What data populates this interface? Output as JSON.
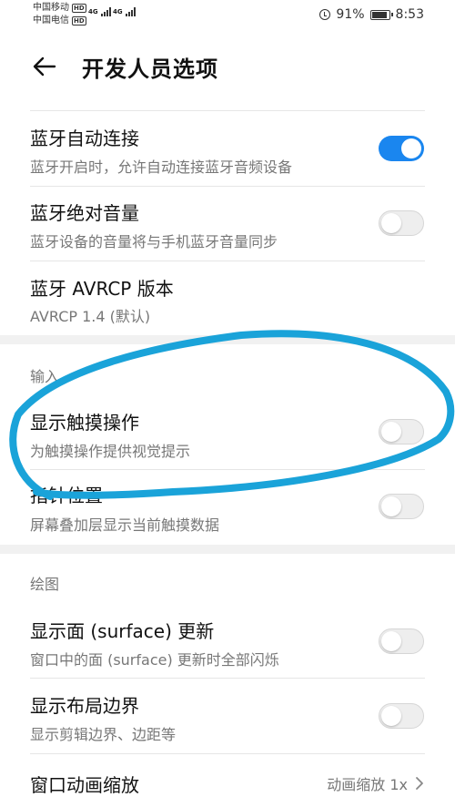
{
  "status_bar": {
    "carrier_1": "中国移动",
    "carrier_2": "中国电信",
    "hd_badge": "HD",
    "network_1": "4G",
    "network_2": "4G",
    "battery": "91%",
    "time": "8:53"
  },
  "header": {
    "title": "开发人员选项"
  },
  "items": [
    {
      "title": "蓝牙自动连接",
      "subtitle": "蓝牙开启时，允许自动连接蓝牙音频设备",
      "toggle": "on"
    },
    {
      "title": "蓝牙绝对音量",
      "subtitle": "蓝牙设备的音量将与手机蓝牙音量同步",
      "toggle": "off"
    },
    {
      "title": "蓝牙 AVRCP 版本",
      "subtitle": "AVRCP 1.4 (默认)"
    }
  ],
  "section_input": {
    "label": "输入",
    "items": [
      {
        "title": "显示触摸操作",
        "subtitle": "为触摸操作提供视觉提示",
        "toggle": "off"
      },
      {
        "title": "指针位置",
        "subtitle": "屏幕叠加层显示当前触摸数据",
        "toggle": "off"
      }
    ]
  },
  "section_drawing": {
    "label": "绘图",
    "items": [
      {
        "title": "显示面 (surface) 更新",
        "subtitle": "窗口中的面 (surface) 更新时全部闪烁",
        "toggle": "off"
      },
      {
        "title": "显示布局边界",
        "subtitle": "显示剪辑边界、边距等",
        "toggle": "off"
      },
      {
        "title": "窗口动画缩放",
        "value": "动画缩放 1x"
      }
    ]
  },
  "colors": {
    "accent": "#1a86ef",
    "annotation": "#1aa3d9"
  }
}
